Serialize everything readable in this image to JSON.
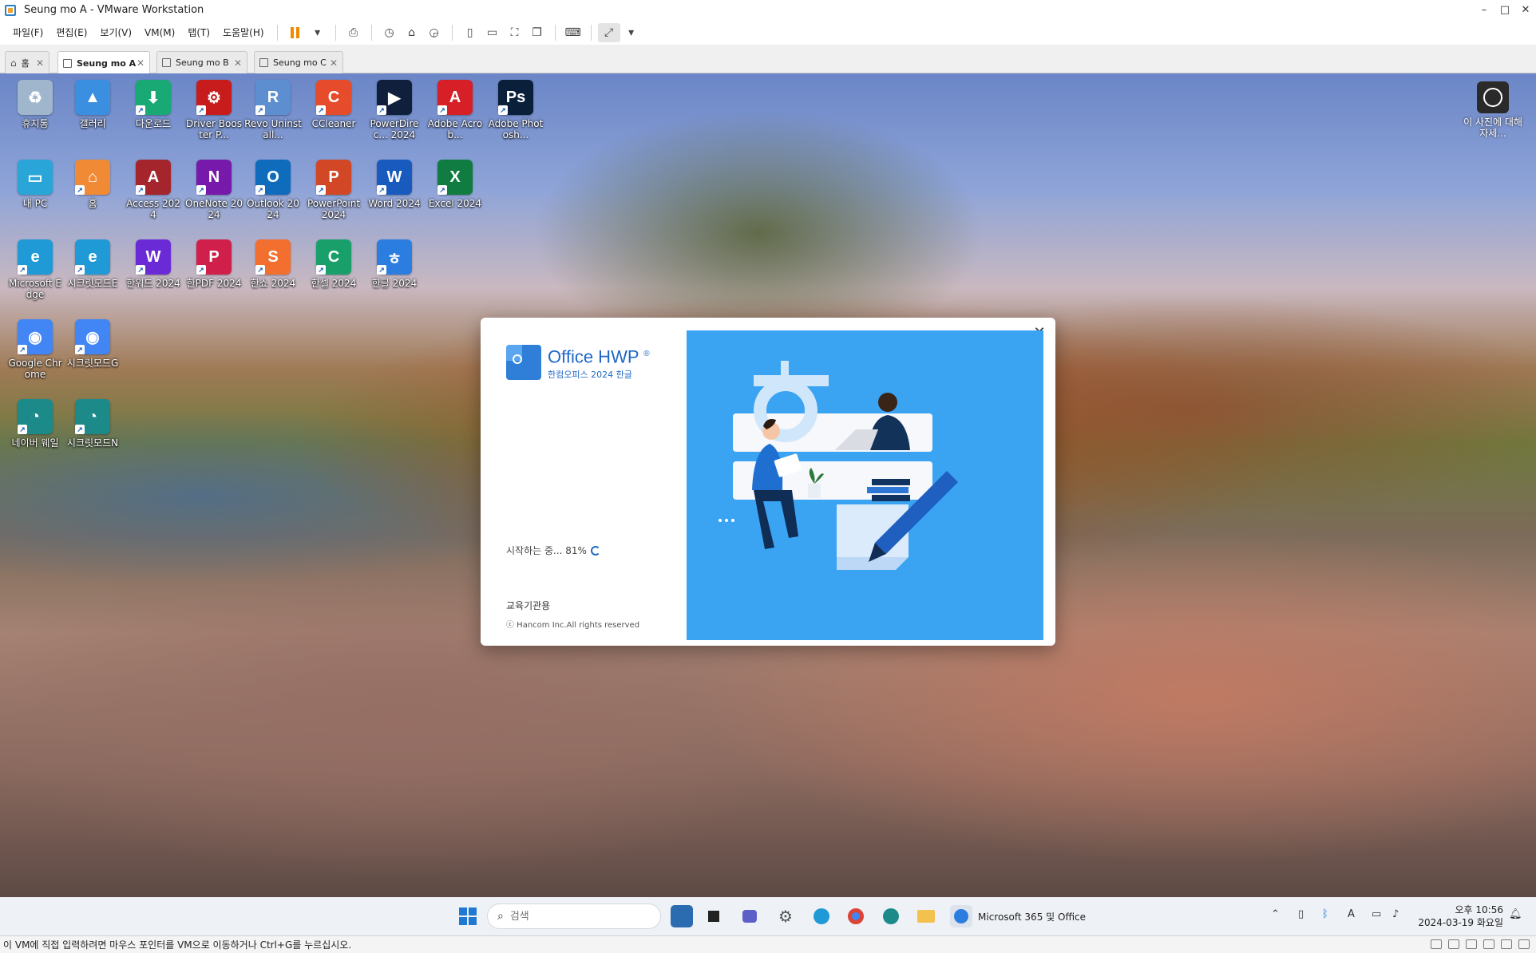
{
  "window": {
    "title": "Seung mo A - VMware Workstation",
    "controls": {
      "minimize": "–",
      "maximize": "□",
      "close": "✕"
    }
  },
  "menu": [
    "파일(F)",
    "편집(E)",
    "보기(V)",
    "VM(M)",
    "탭(T)",
    "도움말(H)"
  ],
  "tabs": [
    {
      "label": "홈",
      "active": false
    },
    {
      "label": "Seung mo A",
      "active": true
    },
    {
      "label": "Seung mo B",
      "active": false
    },
    {
      "label": "Seung mo C",
      "active": false
    }
  ],
  "desktop_icons": [
    {
      "label": "휴지통",
      "icon": "recycle-bin-icon",
      "color": "#9fb6cc",
      "glyph": "♻"
    },
    {
      "label": "갤러리",
      "icon": "gallery-icon",
      "color": "#3b8fe0",
      "glyph": "▲"
    },
    {
      "label": "다운로드",
      "icon": "downloads-icon",
      "color": "#19a974",
      "glyph": "⬇"
    },
    {
      "label": "Driver Booster P...",
      "icon": "driver-booster-icon",
      "color": "#c81c1c",
      "glyph": "⚙"
    },
    {
      "label": "Revo Uninstall...",
      "icon": "revo-uninstaller-icon",
      "color": "#5d8fd0",
      "glyph": "R"
    },
    {
      "label": "CCleaner",
      "icon": "ccleaner-icon",
      "color": "#e64b2b",
      "glyph": "C"
    },
    {
      "label": "PowerDirec... 2024",
      "icon": "powerdirector-icon",
      "color": "#0f1f3c",
      "glyph": "▶"
    },
    {
      "label": "Adobe Acrob...",
      "icon": "adobe-acrobat-icon",
      "color": "#d61f26",
      "glyph": "A"
    },
    {
      "label": "Adobe Photosh...",
      "icon": "adobe-photoshop-icon",
      "color": "#0a1f3a",
      "glyph": "Ps"
    },
    {
      "label": "내 PC",
      "icon": "this-pc-icon",
      "color": "#2aa5d8",
      "glyph": "▭"
    },
    {
      "label": "홈",
      "icon": "home-icon",
      "color": "#f08a35",
      "glyph": "⌂"
    },
    {
      "label": "Access 2024",
      "icon": "access-icon",
      "color": "#a4262c",
      "glyph": "A"
    },
    {
      "label": "OneNote 2024",
      "icon": "onenote-icon",
      "color": "#7719aa",
      "glyph": "N"
    },
    {
      "label": "Outlook 2024",
      "icon": "outlook-icon",
      "color": "#0f6cbd",
      "glyph": "O"
    },
    {
      "label": "PowerPoint 2024",
      "icon": "powerpoint-icon",
      "color": "#d24726",
      "glyph": "P"
    },
    {
      "label": "Word 2024",
      "icon": "word-icon",
      "color": "#185abd",
      "glyph": "W"
    },
    {
      "label": "Excel 2024",
      "icon": "excel-icon",
      "color": "#107c41",
      "glyph": "X"
    },
    {
      "label": "Microsoft Edge",
      "icon": "edge-icon",
      "color": "#1f9ad6",
      "glyph": "e"
    },
    {
      "label": "시크릿모드E",
      "icon": "edge-private-icon",
      "color": "#1f9ad6",
      "glyph": "e"
    },
    {
      "label": "한워드 2024",
      "icon": "hanword-icon",
      "color": "#6a2bd6",
      "glyph": "W"
    },
    {
      "label": "한PDF 2024",
      "icon": "hanpdf-icon",
      "color": "#d11f4b",
      "glyph": "P"
    },
    {
      "label": "한쇼 2024",
      "icon": "hanshow-icon",
      "color": "#f36f2f",
      "glyph": "S"
    },
    {
      "label": "한셀 2024",
      "icon": "hancell-icon",
      "color": "#19a06a",
      "glyph": "C"
    },
    {
      "label": "한글 2024",
      "icon": "hangul-icon",
      "color": "#2b7de0",
      "glyph": "ㅎ"
    },
    {
      "label": "Google Chrome",
      "icon": "chrome-icon",
      "color": "#4285f4",
      "glyph": "◉"
    },
    {
      "label": "시크릿모드G",
      "icon": "chrome-incognito-icon",
      "color": "#4285f4",
      "glyph": "◉"
    },
    {
      "label": "네이버 웨일",
      "icon": "whale-icon",
      "color": "#1d8a8a",
      "glyph": "◔"
    },
    {
      "label": "시크릿모드N",
      "icon": "whale-private-icon",
      "color": "#1d8a8a",
      "glyph": "◔"
    }
  ],
  "photo_info": {
    "label": "이 사진에 대해 자세..."
  },
  "splash": {
    "brand": "Office HWP",
    "registered": "®",
    "subtitle": "한컴오피스 2024 한글",
    "status": "시작하는 중... 81%",
    "progress": 81,
    "edition": "교육기관용",
    "copyright": "ⓒ Hancom Inc.All rights reserved",
    "close": "✕"
  },
  "taskbar": {
    "search_placeholder": "검색",
    "active_label": "Microsoft 365 및 Office",
    "clock_time": "오후 10:56",
    "clock_date": "2024-03-19 화요일"
  },
  "statusbar": {
    "message": "이 VM에 직접 입력하려면 마우스 포인터를 VM으로 이동하거나 Ctrl+G를 누르십시오."
  }
}
